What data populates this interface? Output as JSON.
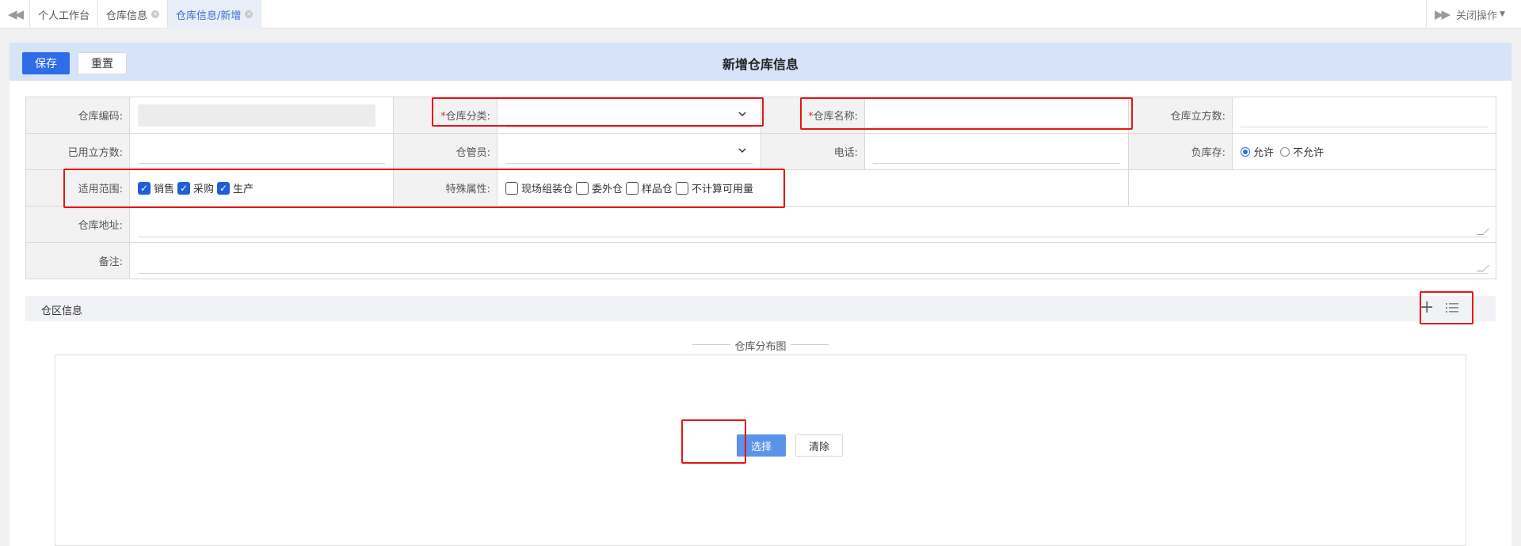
{
  "tabbar": {
    "tabs": [
      {
        "label": "个人工作台",
        "closable": false,
        "active": false
      },
      {
        "label": "仓库信息",
        "closable": true,
        "active": false
      },
      {
        "label": "仓库信息/新增",
        "closable": true,
        "active": true
      }
    ],
    "close_ops_label": "关闭操作",
    "prev_icon": "double-left-arrow-icon",
    "next_icon": "double-right-arrow-icon"
  },
  "header": {
    "save_label": "保存",
    "reset_label": "重置",
    "title": "新增仓库信息"
  },
  "form": {
    "warehouse_code_label": "仓库编码:",
    "warehouse_category_label": "仓库分类:",
    "warehouse_name_label": "仓库名称:",
    "warehouse_volume_label": "仓库立方数:",
    "used_volume_label": "已用立方数:",
    "keeper_label": "仓管员:",
    "phone_label": "电话:",
    "negative_stock_label": "负库存:",
    "negative_stock_options": [
      "允许",
      "不允许"
    ],
    "negative_stock_selected": "允许",
    "scope_label": "适用范围:",
    "scope_options": [
      {
        "label": "销售",
        "checked": true
      },
      {
        "label": "采购",
        "checked": true
      },
      {
        "label": "生产",
        "checked": true
      }
    ],
    "special_label": "特殊属性:",
    "special_options": [
      {
        "label": "现场组装仓",
        "checked": false
      },
      {
        "label": "委外仓",
        "checked": false
      },
      {
        "label": "样品仓",
        "checked": false
      },
      {
        "label": "不计算可用量",
        "checked": false
      }
    ],
    "address_label": "仓库地址:",
    "remark_label": "备注:",
    "required_mark": "*"
  },
  "section": {
    "title": "仓区信息"
  },
  "distribution": {
    "label": "仓库分布图",
    "choose_label": "选择",
    "clear_label": "清除"
  },
  "colors": {
    "primary": "#2f6ce8",
    "header_bg": "#d6e3f8",
    "highlight": "#e81515"
  }
}
